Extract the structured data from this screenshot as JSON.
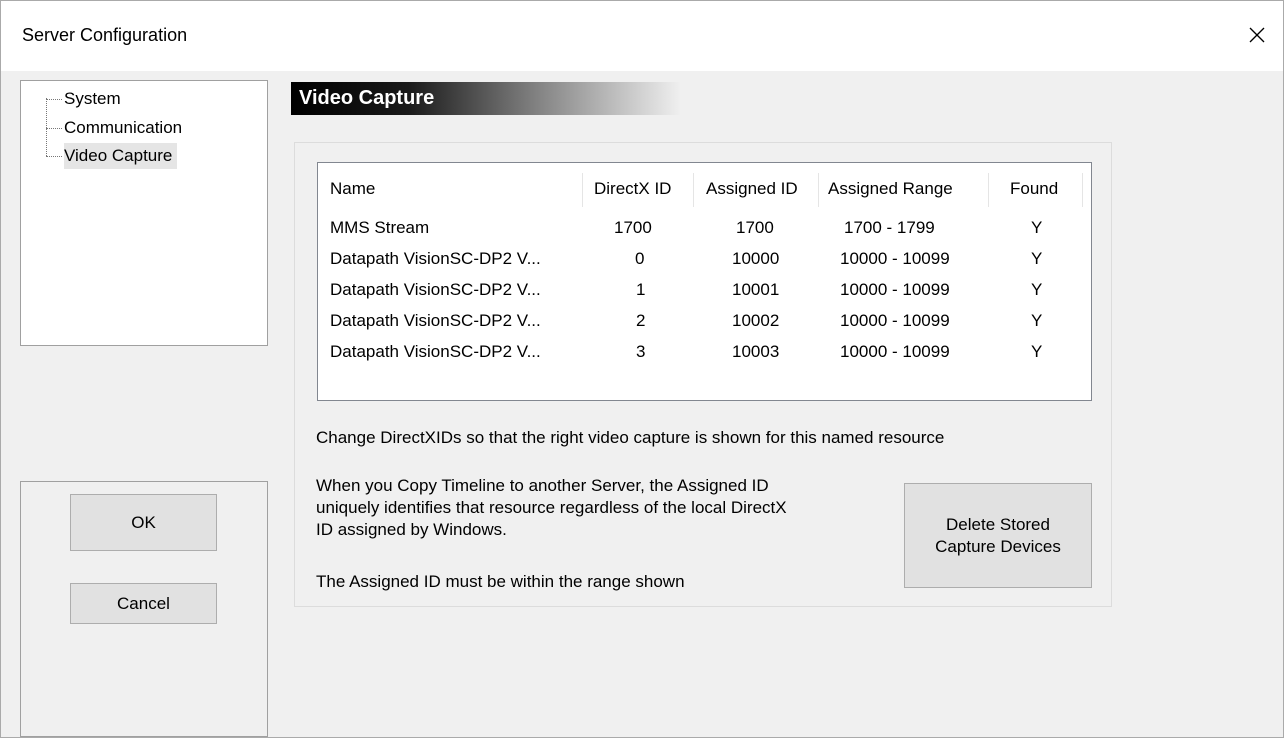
{
  "window": {
    "title": "Server Configuration",
    "close_icon": "close-icon"
  },
  "tree": {
    "items": [
      {
        "label": "System"
      },
      {
        "label": "Communication"
      },
      {
        "label": "Video Capture"
      }
    ],
    "selected": "Video Capture"
  },
  "buttons": {
    "ok": "OK",
    "cancel": "Cancel",
    "delete_stored": [
      "Delete Stored",
      "Capture Devices"
    ]
  },
  "section": {
    "title": "Video Capture"
  },
  "table": {
    "columns": [
      "Name",
      "DirectX ID",
      "Assigned ID",
      "Assigned Range",
      "Found"
    ],
    "rows": [
      [
        "MMS Stream",
        "1700",
        "1700",
        "1700 - 1799",
        "Y"
      ],
      [
        "Datapath VisionSC-DP2 V...",
        "0",
        "10000",
        "10000 - 10099",
        "Y"
      ],
      [
        "Datapath VisionSC-DP2 V...",
        "1",
        "10001",
        "10000 - 10099",
        "Y"
      ],
      [
        "Datapath VisionSC-DP2 V...",
        "2",
        "10002",
        "10000 - 10099",
        "Y"
      ],
      [
        "Datapath VisionSC-DP2 V...",
        "3",
        "10003",
        "10000 - 10099",
        "Y"
      ]
    ]
  },
  "notes": {
    "change": "Change DirectXIDs so that the right video capture is shown for this named resource",
    "copy_lines": [
      "When you Copy Timeline to another Server, the Assigned ID",
      "uniquely identifies that resource regardless of the local DirectX",
      "ID assigned by Windows."
    ],
    "range": "The Assigned ID must be within the range shown"
  }
}
